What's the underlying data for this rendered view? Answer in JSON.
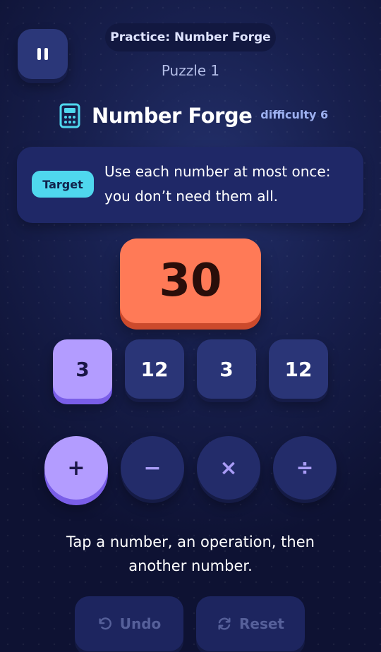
{
  "header": {
    "practice_label": "Practice: Number Forge",
    "puzzle_label": "Puzzle 1",
    "title": "Number Forge",
    "difficulty": "difficulty 6",
    "pause_icon": "pause-icon",
    "title_icon": "calculator-icon"
  },
  "instructions": {
    "badge": "Target",
    "text": "Use each number at most once: you don’t need them all."
  },
  "target": {
    "value": "30"
  },
  "numbers": [
    {
      "value": "3",
      "selected": true
    },
    {
      "value": "12",
      "selected": false
    },
    {
      "value": "3",
      "selected": false
    },
    {
      "value": "12",
      "selected": false
    }
  ],
  "operations": [
    {
      "symbol": "+",
      "name": "plus",
      "selected": true
    },
    {
      "symbol": "−",
      "name": "minus",
      "selected": false
    },
    {
      "symbol": "×",
      "name": "multiply",
      "selected": false
    },
    {
      "symbol": "÷",
      "name": "divide",
      "selected": false
    }
  ],
  "hint": "Tap a number, an operation, then another number.",
  "actions": {
    "undo_label": "Undo",
    "reset_label": "Reset",
    "undo_icon": "undo-icon",
    "reset_icon": "reset-icon"
  },
  "colors": {
    "target_tile": "#ff7a57",
    "selected_tile": "#b39cff",
    "badge": "#4fd7ee",
    "tile": "#2a3577"
  }
}
